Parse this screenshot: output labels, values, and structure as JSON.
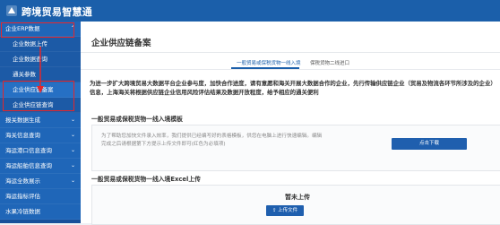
{
  "app": {
    "title": "跨境贸易智慧通"
  },
  "sidebar": {
    "items": [
      {
        "label": "企业ERP数据",
        "kind": "parent",
        "expanded": true
      },
      {
        "label": "企业数据上传",
        "kind": "sub"
      },
      {
        "label": "企业数据查询",
        "kind": "sub"
      },
      {
        "label": "通关参数",
        "kind": "sub"
      },
      {
        "label": "企业供应链备案",
        "kind": "sub",
        "active": true
      },
      {
        "label": "企业供应链查询",
        "kind": "sub"
      },
      {
        "label": "报关数据生成",
        "kind": "parent"
      },
      {
        "label": "海关信息查询",
        "kind": "parent"
      },
      {
        "label": "海运港口信息查询",
        "kind": "parent"
      },
      {
        "label": "海运船舶信息查询",
        "kind": "parent"
      },
      {
        "label": "海运全数展示",
        "kind": "parent"
      },
      {
        "label": "海运指标评估",
        "kind": "parent"
      },
      {
        "label": "水果冷链数据",
        "kind": "parent"
      }
    ]
  },
  "main": {
    "title": "企业供应链备案",
    "tabs": [
      {
        "label": "一般贸易或保税货物一线入境",
        "active": true
      },
      {
        "label": "保税货物二线进口",
        "active": false
      }
    ],
    "intro": "为进一步扩大跨境贸易大数据平台企业参与度，加快合作进度，请有意愿和海关开展大数据合作的企业，先行传输供应链企业（贸易及物流各环节所涉及的企业）信息，上海海关将根据供应链企业信用风险评估结果及数据开放程度，给予相应的通关便利",
    "template_section": {
      "title": "一般贸易或保税货物一线入境模板",
      "description": "为了帮助您加快文件录入效率，我们提供已经编写好的表格模板，供您在电脑上进行快速编辑。编辑完成之后请根据第下方提示上传文件即可(红色为必填项)",
      "download_label": "点击下载"
    },
    "upload_section": {
      "title": "一般贸易或保税货物一线入境Excel上传",
      "status": "暂未上传",
      "upload_label": "上传文件"
    }
  },
  "colors": {
    "topbar": "#1b5faa",
    "sidebar": "#174f9a",
    "accent": "#1f5fae",
    "highlight": "#e5262b"
  }
}
